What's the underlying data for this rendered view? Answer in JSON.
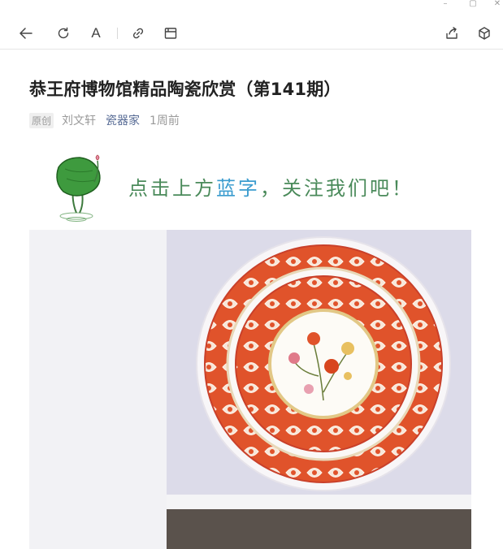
{
  "window_controls": [
    {
      "name": "minimize-button",
      "glyph": "–"
    },
    {
      "name": "maximize-button",
      "glyph": "▢"
    },
    {
      "name": "close-button",
      "glyph": "✕"
    }
  ],
  "toolbar": {
    "font_label": "A"
  },
  "article": {
    "title": "恭王府博物馆精品陶瓷欣赏（第141期）",
    "tag": "原创",
    "author": "刘文轩",
    "account": "瓷器家",
    "time": "1周前"
  },
  "banner": {
    "text_before": "点击上方",
    "text_highlight": "蓝字",
    "text_after": "，关注我们吧！"
  },
  "colors": {
    "link": "#576b95",
    "banner_green": "#4a8a5a",
    "banner_blue": "#3b9ccf",
    "dish_red": "#e0532b"
  }
}
